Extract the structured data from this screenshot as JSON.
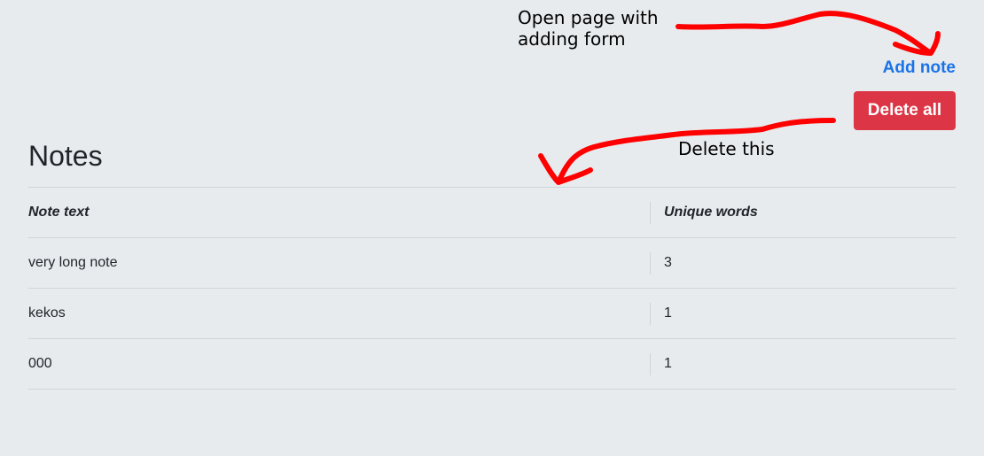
{
  "header": {
    "add_note_label": "Add note",
    "delete_all_label": "Delete all"
  },
  "annotations": {
    "open_page": "Open page with\nadding form",
    "delete_this": "Delete this",
    "arrow_color": "#ff0000"
  },
  "main": {
    "title": "Notes",
    "table": {
      "columns": [
        "Note text",
        "Unique words"
      ],
      "rows": [
        {
          "text": "very long note",
          "unique_words": "3"
        },
        {
          "text": "kekos",
          "unique_words": "1"
        },
        {
          "text": "000",
          "unique_words": "1"
        }
      ]
    }
  },
  "colors": {
    "background": "#e8ebee",
    "link": "#1a73e8",
    "danger": "#dc3545"
  }
}
